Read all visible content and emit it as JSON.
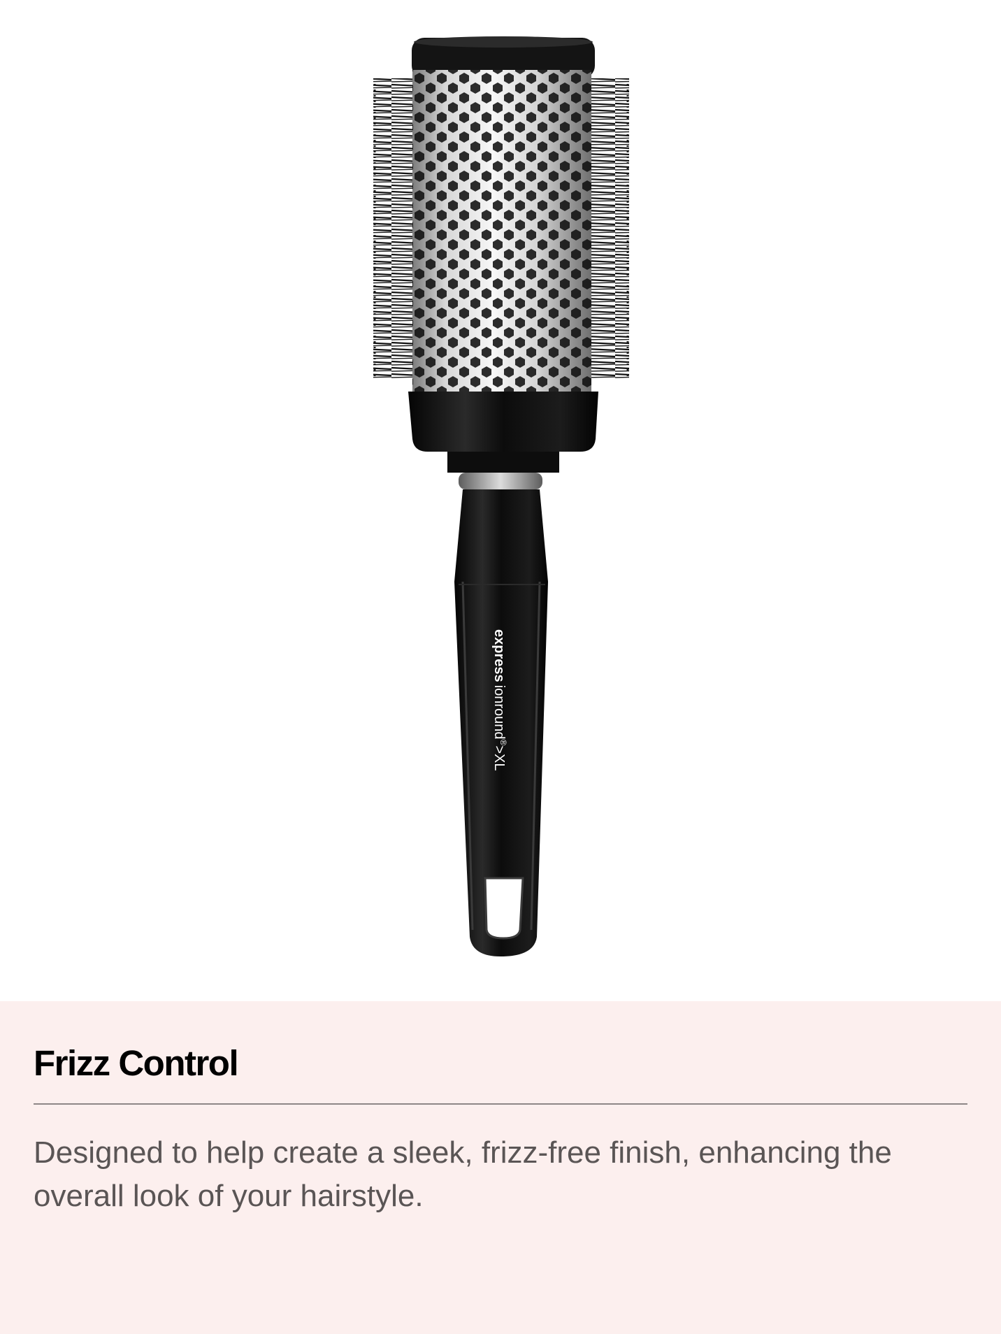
{
  "theme": {
    "panel_background": "#fcefee",
    "page_background": "#ffffff",
    "title_color": "#000000",
    "body_color": "#5a5555",
    "divider_color": "#8d8686"
  },
  "product": {
    "image_icon": "round-brush-image",
    "handle_brand": "express",
    "handle_product": "ionround",
    "handle_mark": "®",
    "handle_size": ">XL"
  },
  "feature": {
    "title": "Frizz Control",
    "description": "Designed to help create a sleek, frizz-free finish, enhancing the overall look of your hairstyle."
  }
}
